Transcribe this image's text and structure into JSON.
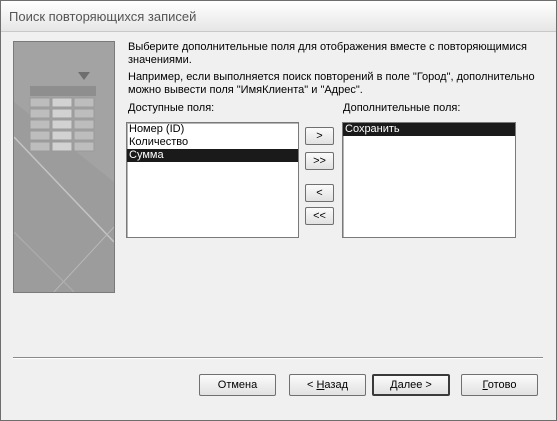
{
  "window": {
    "title": "Поиск повторяющихся записей"
  },
  "description": {
    "line1": "Выберите дополнительные поля для отображения вместе с повторяющимися значениями.",
    "line2": "Например, если выполняется поиск повторений в поле \"Город\", дополнительно можно вывести поля \"ИмяКлиента\" и \"Адрес\"."
  },
  "available": {
    "label": "Доступные поля:",
    "items": [
      {
        "text": "Номер (ID)",
        "selected": false
      },
      {
        "text": "Количество",
        "selected": false
      },
      {
        "text": "Сумма",
        "selected": true
      }
    ]
  },
  "additional": {
    "label": "Дополнительные поля:",
    "items": [
      {
        "text": "Сохранить",
        "selected": true
      }
    ]
  },
  "move_buttons": {
    "add_one": ">",
    "add_all": ">>",
    "remove_one": "<",
    "remove_all": "<<"
  },
  "footer": {
    "cancel": "Отмена",
    "back_prefix": "< ",
    "back_key": "Н",
    "back_rest": "азад",
    "next_key": "Д",
    "next_rest": "алее >",
    "finish_key": "Г",
    "finish_rest": "отово"
  }
}
